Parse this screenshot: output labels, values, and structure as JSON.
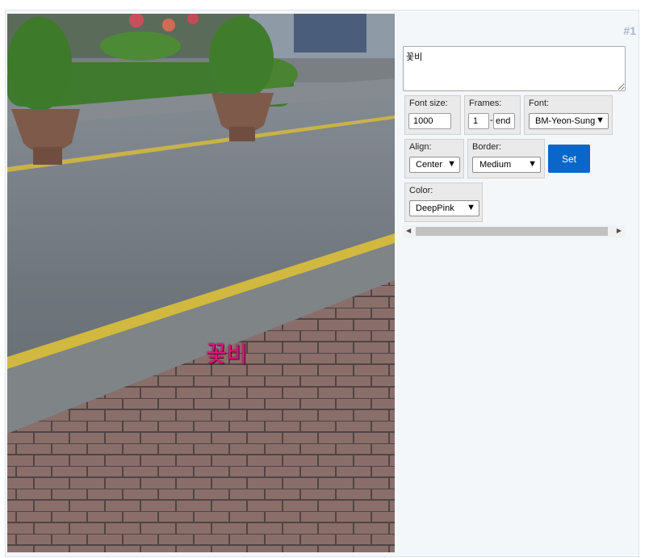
{
  "panel": {
    "id_label": "#1"
  },
  "caption": {
    "text": "꽃비",
    "color": "#e0157f"
  },
  "text_input": {
    "value": "꽃비"
  },
  "font_size": {
    "label": "Font size:",
    "value": "1000"
  },
  "frames": {
    "label": "Frames:",
    "start": "1",
    "separator": "-",
    "end": "end"
  },
  "font": {
    "label": "Font:",
    "selected": "BM-Yeon-Sung"
  },
  "align": {
    "label": "Align:",
    "selected": "Center"
  },
  "border": {
    "label": "Border:",
    "selected": "Medium"
  },
  "set_button": {
    "label": "Set"
  },
  "color": {
    "label": "Color:",
    "selected": "DeepPink"
  },
  "icons": {
    "dropdown": "▼",
    "scroll_left": "◀",
    "scroll_right": "▶"
  }
}
